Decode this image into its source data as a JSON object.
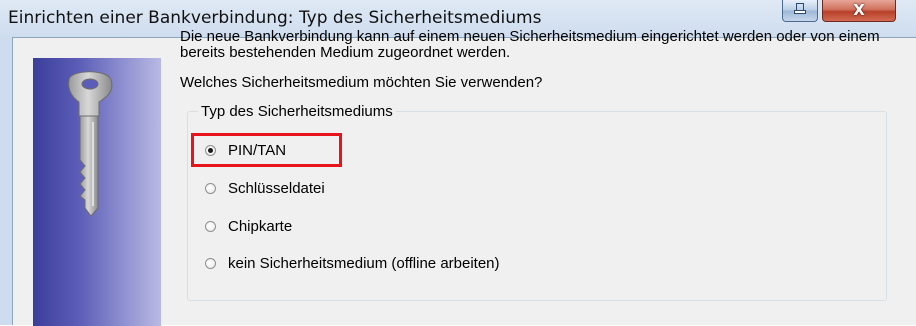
{
  "window": {
    "title": "Einrichten einer Bankverbindung: Typ des Sicherheitsmediums",
    "close_glyph": "X"
  },
  "content": {
    "intro": "Die neue Bankverbindung kann  auf einem neuen Sicherheitsmedium eingerichtet werden oder von einem bereits bestehenden Medium zugeordnet werden.",
    "question": "Welches Sicherheitsmedium möchten Sie verwenden?"
  },
  "group": {
    "legend": "Typ des Sicherheitsmediums",
    "options": [
      {
        "label": "PIN/TAN",
        "checked": true
      },
      {
        "label": "Schlüsseldatei",
        "checked": false
      },
      {
        "label": "Chipkarte",
        "checked": false
      },
      {
        "label": "kein Sicherheitsmedium (offline arbeiten)",
        "checked": false
      }
    ],
    "selected": "PIN/TAN"
  },
  "colors": {
    "highlight": "#e8141c",
    "sidebar_gradient_start": "#3c3f9a",
    "sidebar_gradient_end": "#b9b9e4"
  },
  "icons": {
    "sidebar": "key-icon"
  }
}
